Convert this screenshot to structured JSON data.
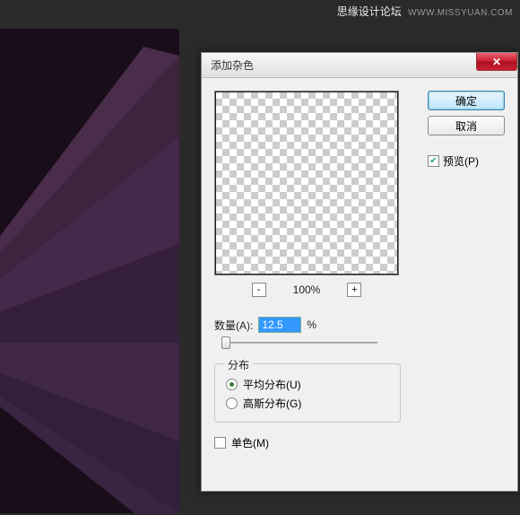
{
  "watermark": {
    "cn": "思缘设计论坛",
    "url": "WWW.MISSYUAN.COM"
  },
  "dialog": {
    "title": "添加杂色",
    "buttons": {
      "ok": "确定",
      "cancel": "取消"
    },
    "preview_check": {
      "checked": true,
      "label": "预览(P)"
    },
    "zoom": {
      "minus": "-",
      "pct": "100%",
      "plus": "+"
    },
    "amount": {
      "label": "数量(A):",
      "value": "12.5",
      "suffix": "%"
    },
    "distribution": {
      "legend": "分布",
      "uniform": {
        "label": "平均分布(U)",
        "selected": true
      },
      "gaussian": {
        "label": "高斯分布(G)",
        "selected": false
      }
    },
    "mono": {
      "label": "单色(M)",
      "checked": false
    }
  }
}
